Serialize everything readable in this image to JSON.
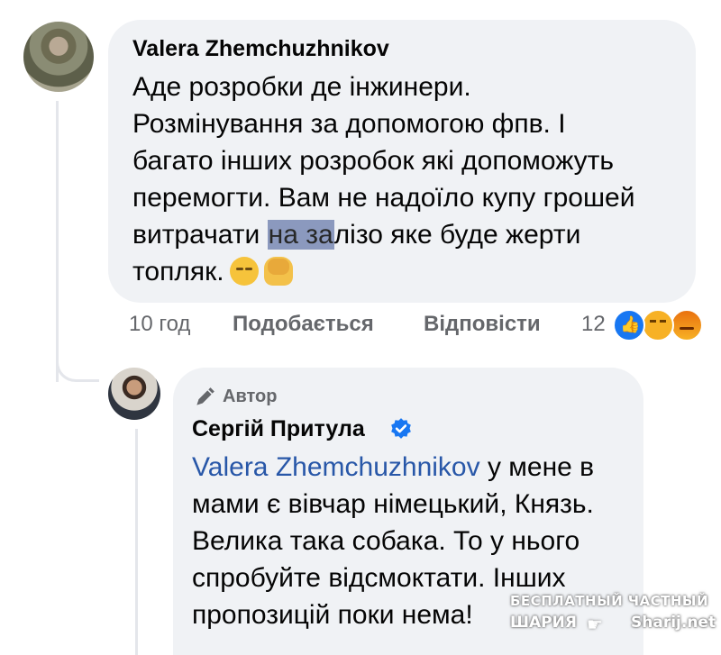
{
  "comment1": {
    "author": "Valera Zhemchuzhnikov",
    "lines": [
      "Аде розробки де інжинери.",
      "Розмінування за допомогою фпв. І",
      "багато інших розробок які допоможуть",
      "перемогти. Вам не надоїло купу грошей"
    ],
    "line5_pre": "витрачати ",
    "line5_redacted": "на за",
    "line5_post": "лізо яке буде жерти",
    "line6": "топляк.",
    "emojis": [
      "pensive-face",
      "person-facepalming"
    ],
    "time": "10 год",
    "like_label": "Подобається",
    "reply_label": "Відповісти",
    "reaction_count": "12",
    "reactions": [
      "like",
      "haha",
      "angry"
    ]
  },
  "comment2": {
    "badge_label": "Автор",
    "author": "Сергій Притула",
    "verified": true,
    "mention": "Valera Zhemchuzhnikov",
    "line1_post": " у мене в",
    "lines": [
      "мами є вівчар німецький, Князь.",
      "Велика така собака. То у нього",
      "спробуйте відсмоктати. Інших",
      "пропозицій поки нема!"
    ]
  },
  "watermark": {
    "line1": "БЕСПЛАТНЫЙ ЧАСТНЫЙ",
    "line2": "ШАРИЯ",
    "line3": "Sharij.net"
  },
  "colors": {
    "bubble": "#f0f2f5",
    "mention": "#2857a8",
    "meta": "#65676b",
    "like": "#1877f2",
    "verified": "#1877f2"
  }
}
